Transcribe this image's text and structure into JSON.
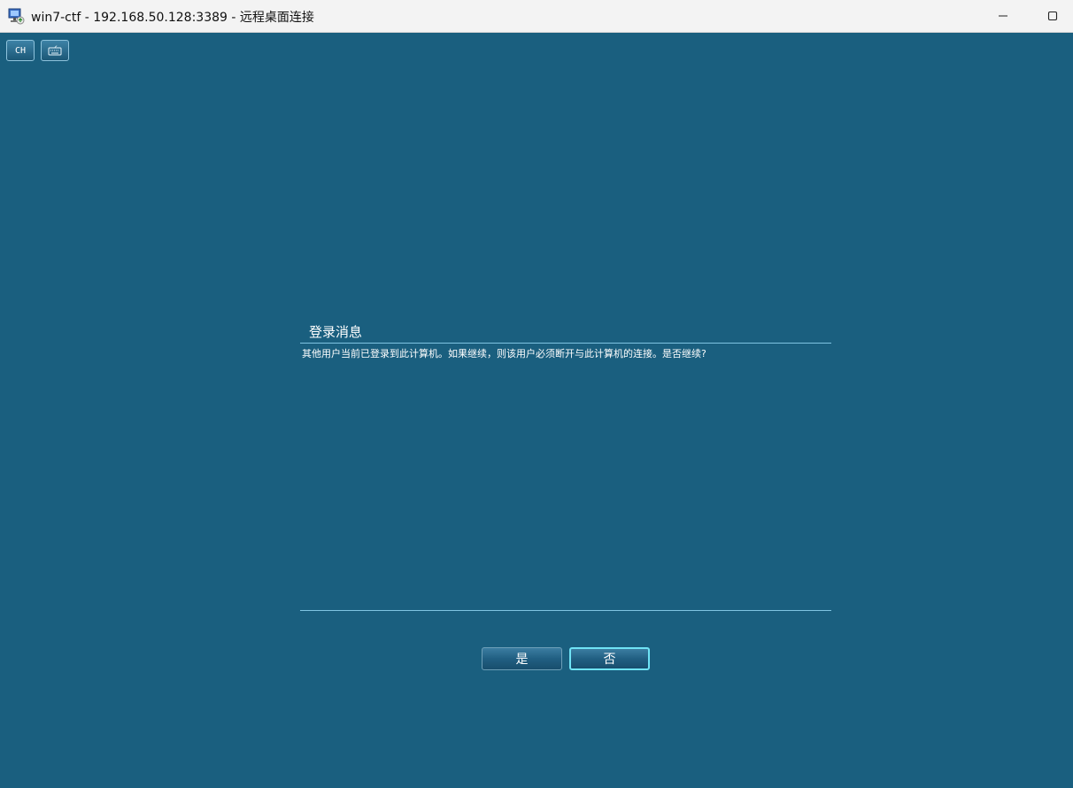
{
  "titlebar": {
    "title": "win7-ctf - 192.168.50.128:3389 - 远程桌面连接",
    "icon": "remote-desktop-icon",
    "minimize_icon": "minimize-icon",
    "maximize_icon": "maximize-icon"
  },
  "remote_toolbar": {
    "language_label": "CH",
    "keyboard_icon": "keyboard-icon"
  },
  "dialog": {
    "title": "登录消息",
    "message": "其他用户当前已登录到此计算机。如果继续，则该用户必须断开与此计算机的连接。是否继续?",
    "yes_label": "是",
    "no_label": "否"
  },
  "colors": {
    "background": "#1a5f7f",
    "rule": "#7fc4e2",
    "focus_border": "#6fe3f5"
  }
}
